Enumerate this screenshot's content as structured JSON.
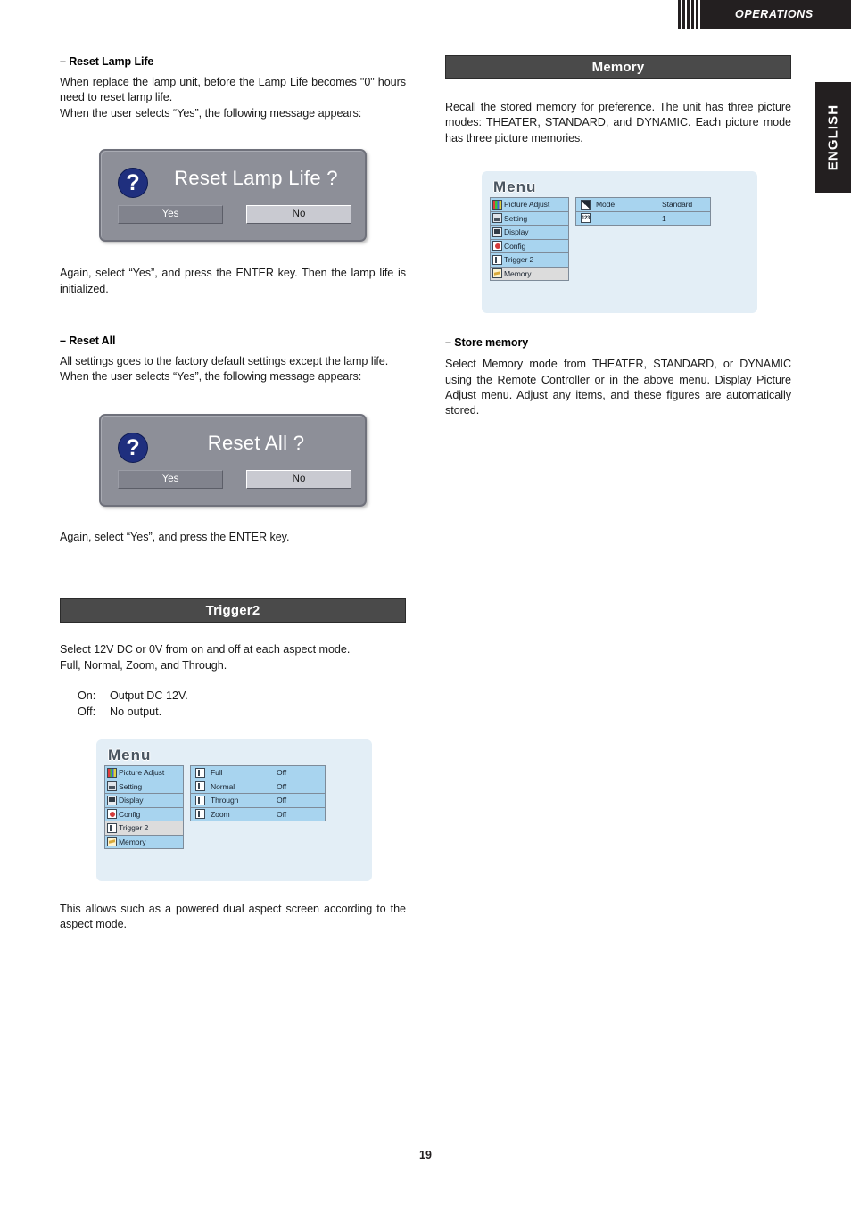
{
  "header": {
    "title": "OPERATIONS",
    "side_tab": "ENGLISH"
  },
  "footer": {
    "page_number": "19"
  },
  "colors": {
    "header_bar": "#231f20",
    "section_bar": "#4a4a4a",
    "osd_dialog_bg": "#8d8f98",
    "osd_menu_bg": "#e3eef6",
    "osd_row_bg": "#a8d4ef",
    "osd_row_active_bg": "#dcdcdc",
    "question_badge": "#1f2f7e"
  },
  "left_column": {
    "reset_lamp_life": {
      "heading": "– Reset Lamp Life",
      "paragraph": "When replace the lamp unit, before the Lamp Life becomes \"0\" hours need to reset lamp life.\nWhen the user selects “Yes”, the following message appears:",
      "dialog": {
        "icon": "question-mark-icon",
        "title": "Reset Lamp Life ?",
        "button_yes": "Yes",
        "button_no": "No",
        "selected_button": "No"
      },
      "after_paragraph": "Again, select “Yes”, and press the ENTER key. Then the lamp life is initialized."
    },
    "reset_all": {
      "heading": "– Reset All",
      "paragraph": "All settings goes to the factory default settings except the lamp life.\nWhen the user selects “Yes”, the following message appears:",
      "dialog": {
        "icon": "question-mark-icon",
        "title": "Reset All ?",
        "button_yes": "Yes",
        "button_no": "No",
        "selected_button": "No"
      },
      "after_paragraph": "Again, select “Yes”, and press the ENTER key."
    },
    "trigger2": {
      "section_title": "Trigger2",
      "paragraph": "Select 12V DC or 0V from on and off at each aspect mode.\nFull, Normal, Zoom, and Through.",
      "on_off_list": [
        {
          "key": "On:",
          "value": "Output DC 12V."
        },
        {
          "key": "Off:",
          "value": "No output."
        }
      ],
      "menu": {
        "title": "Menu",
        "left_items": [
          {
            "label": "Picture Adjust",
            "icon": "picture-adjust-icon",
            "active": false
          },
          {
            "label": "Setting",
            "icon": "setting-icon",
            "active": false
          },
          {
            "label": "Display",
            "icon": "display-icon",
            "active": false
          },
          {
            "label": "Config",
            "icon": "config-icon",
            "active": false
          },
          {
            "label": "Trigger 2",
            "icon": "trigger-icon",
            "active": true
          },
          {
            "label": "Memory",
            "icon": "memory-icon",
            "active": false
          }
        ],
        "right_items": [
          {
            "label": "Full",
            "value": "Off",
            "icon": "trigger-icon"
          },
          {
            "label": "Normal",
            "value": "Off",
            "icon": "trigger-icon"
          },
          {
            "label": "Through",
            "value": "Off",
            "icon": "trigger-icon"
          },
          {
            "label": "Zoom",
            "value": "Off",
            "icon": "trigger-icon"
          }
        ]
      },
      "after_paragraph": "This allows such as a powered dual aspect screen according to the aspect mode."
    }
  },
  "right_column": {
    "memory": {
      "section_title": "Memory",
      "paragraph": "Recall the stored memory for preference. The unit has three picture modes: THEATER, STANDARD, and DYNAMIC. Each picture mode has three picture memories.",
      "menu": {
        "title": "Menu",
        "left_items": [
          {
            "label": "Picture Adjust",
            "icon": "picture-adjust-icon",
            "active": false
          },
          {
            "label": "Setting",
            "icon": "setting-icon",
            "active": false
          },
          {
            "label": "Display",
            "icon": "display-icon",
            "active": false
          },
          {
            "label": "Config",
            "icon": "config-icon",
            "active": false
          },
          {
            "label": "Trigger 2",
            "icon": "trigger-icon",
            "active": false
          },
          {
            "label": "Memory",
            "icon": "memory-icon",
            "active": true
          }
        ],
        "right_items": [
          {
            "label": "Mode",
            "value": "Standard",
            "icon": "mode-icon"
          },
          {
            "label": "",
            "value": "1",
            "icon": "number-icon"
          }
        ]
      }
    },
    "store_memory": {
      "heading": "– Store memory",
      "paragraph": "Select Memory mode from THEATER, STANDARD, or DYNAMIC using the Remote Controller or in the above menu. Display  Picture Adjust menu. Adjust any items, and these figures are automatically stored."
    }
  }
}
